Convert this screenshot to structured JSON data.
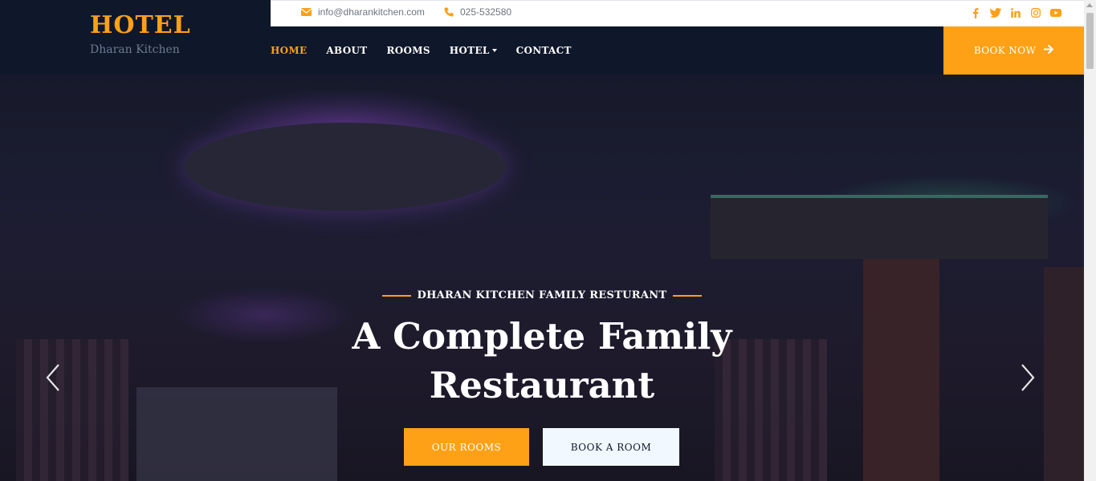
{
  "brand": {
    "title": "HOTEL",
    "subtitle": "Dharan Kitchen"
  },
  "topbar": {
    "email": "info@dharankitchen.com",
    "phone": "025-532580",
    "socials": [
      "facebook-icon",
      "twitter-icon",
      "linkedin-icon",
      "instagram-icon",
      "youtube-icon"
    ]
  },
  "nav": {
    "items": [
      {
        "label": "HOME",
        "active": true
      },
      {
        "label": "ABOUT"
      },
      {
        "label": "ROOMS"
      },
      {
        "label": "HOTEL",
        "dropdown": true
      },
      {
        "label": "CONTACT"
      }
    ],
    "book_now": "BOOK NOW"
  },
  "hero": {
    "kicker": "DHARAN KITCHEN FAMILY RESTURANT",
    "headline": "A Complete Family Restaurant",
    "primary_button": "OUR ROOMS",
    "secondary_button": "BOOK A ROOM"
  },
  "colors": {
    "accent": "#fea116",
    "dark": "#0f172b",
    "light_button": "#f1f8ff"
  }
}
